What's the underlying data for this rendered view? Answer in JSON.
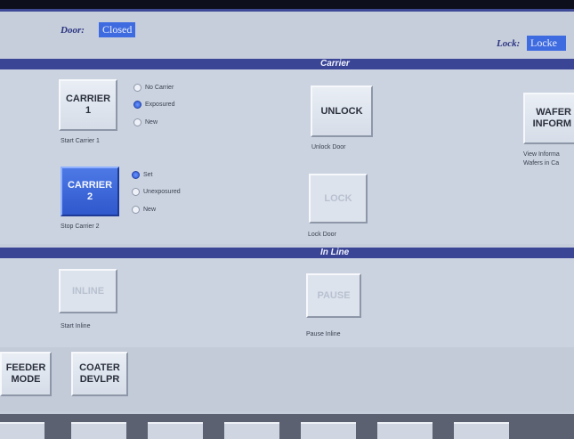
{
  "status": {
    "door_label": "Door:",
    "door_value": "Closed",
    "lock_label": "Lock:",
    "lock_value": "Locke"
  },
  "carrier_section": {
    "title": "Carrier",
    "carrier1": {
      "label_line1": "CARRIER",
      "label_line2": "1",
      "caption": "Start Carrier 1",
      "options": [
        "No Carrier",
        "Exposured",
        "New"
      ],
      "selected": "Exposured"
    },
    "carrier2": {
      "label_line1": "CARRIER",
      "label_line2": "2",
      "caption": "Stop Carrier 2",
      "options": [
        "Set",
        "Unexposured",
        "New"
      ],
      "selected": "Set"
    },
    "unlock": {
      "label": "UNLOCK",
      "caption": "Unlock Door"
    },
    "lock": {
      "label": "LOCK",
      "caption": "Lock Door"
    },
    "wafer": {
      "label_line1": "WAFER",
      "label_line2": "INFORM",
      "caption_line1": "View Informa",
      "caption_line2": "Wafers in Ca"
    }
  },
  "inline_section": {
    "title": "In Line",
    "inline": {
      "label": "INLINE",
      "caption": "Start Inline"
    },
    "pause": {
      "label": "PAUSE",
      "caption": "Pause Inline"
    }
  },
  "mode_buttons": {
    "feeder_line1": "FEEDER",
    "feeder_line2": "MODE",
    "coater_line1": "COATER",
    "coater_line2": "DEVLPR"
  },
  "colors": {
    "section_bar": "#3a4596",
    "active_button": "#3a66de",
    "panel": "#c6cedc"
  }
}
